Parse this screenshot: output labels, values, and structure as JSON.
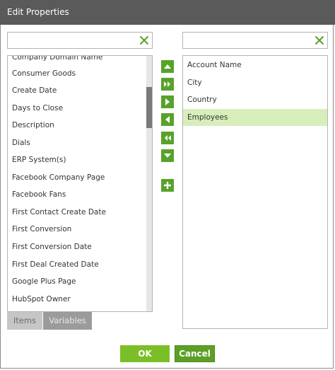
{
  "window": {
    "title": "Edit Properties"
  },
  "left_search": {
    "value": "",
    "placeholder": ""
  },
  "right_search": {
    "value": "",
    "placeholder": ""
  },
  "available_items": [
    "Company Domain Name",
    "Consumer Goods",
    "Create Date",
    "Days to Close",
    "Description",
    "Dials",
    "ERP System(s)",
    "Facebook Company Page",
    "Facebook Fans",
    "First Contact Create Date",
    "First Conversion",
    "First Conversion Date",
    "First Deal Created Date",
    "Google Plus Page",
    "HubSpot Owner"
  ],
  "selected_items": [
    "Account Name",
    "City",
    "Country",
    "Employees"
  ],
  "highlighted_selected": "Employees",
  "tabs": {
    "items": "Items",
    "variables": "Variables"
  },
  "buttons": {
    "ok": "OK",
    "cancel": "Cancel"
  },
  "colors": {
    "accent_green": "#58a22a",
    "ok_green": "#7bbf28",
    "selection_bg": "#d7eebb",
    "clear_icon": "#5aa02a",
    "titlebar": "#5a5a5a"
  },
  "icons": {
    "move_up": "triangle-up-icon",
    "move_all_right": "double-chevron-right-icon",
    "move_right": "triangle-right-icon",
    "move_left": "triangle-left-icon",
    "move_all_left": "double-chevron-left-icon",
    "move_down": "triangle-down-icon",
    "add": "plus-icon",
    "clear": "close-x-icon"
  }
}
